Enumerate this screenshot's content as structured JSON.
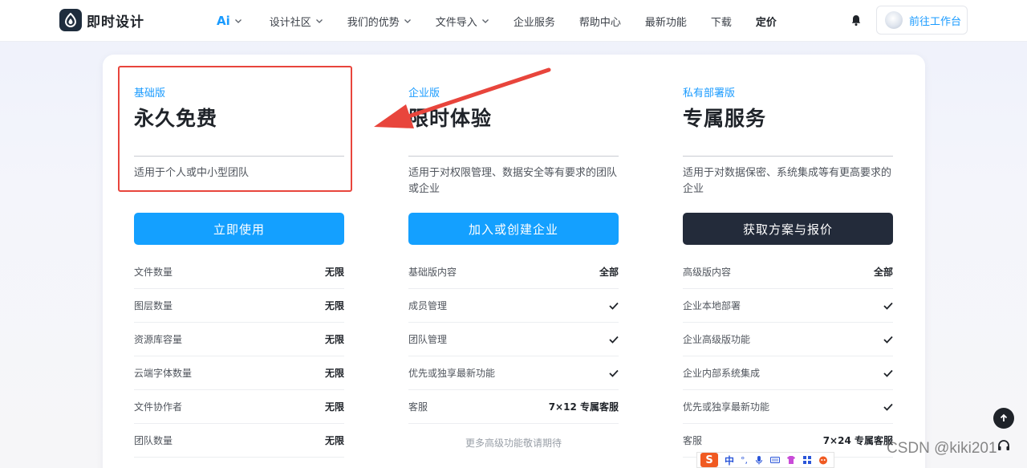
{
  "brand": {
    "name": "即时设计"
  },
  "nav": {
    "items": [
      {
        "label": "Ai",
        "dropdown": true
      },
      {
        "label": "设计社区",
        "dropdown": true
      },
      {
        "label": "我们的优势",
        "dropdown": true
      },
      {
        "label": "文件导入",
        "dropdown": true
      },
      {
        "label": "企业服务",
        "dropdown": false
      },
      {
        "label": "帮助中心",
        "dropdown": false
      },
      {
        "label": "最新功能",
        "dropdown": false
      },
      {
        "label": "下载",
        "dropdown": false
      },
      {
        "label": "定价",
        "dropdown": false,
        "active": true
      }
    ],
    "workbench_label": "前往工作台"
  },
  "plans": [
    {
      "tag": "基础版",
      "name": "永久免费",
      "desc": "适用于个人或中小型团队",
      "cta": "立即使用",
      "features": [
        {
          "label": "文件数量",
          "value": "无限"
        },
        {
          "label": "图层数量",
          "value": "无限"
        },
        {
          "label": "资源库容量",
          "value": "无限"
        },
        {
          "label": "云端字体数量",
          "value": "无限"
        },
        {
          "label": "文件协作者",
          "value": "无限"
        },
        {
          "label": "团队数量",
          "value": "无限"
        }
      ]
    },
    {
      "tag": "企业版",
      "name": "限时体验",
      "desc": "适用于对权限管理、数据安全等有要求的团队或企业",
      "cta": "加入或创建企业",
      "features": [
        {
          "label": "基础版内容",
          "value": "全部"
        },
        {
          "label": "成员管理",
          "value": "check"
        },
        {
          "label": "团队管理",
          "value": "check"
        },
        {
          "label": "优先或独享最新功能",
          "value": "check"
        },
        {
          "label": "客服",
          "value": "7×12 专属客服"
        }
      ],
      "note": "更多高级功能敬请期待"
    },
    {
      "tag": "私有部署版",
      "name": "专属服务",
      "desc": "适用于对数据保密、系统集成等有更高要求的企业",
      "cta": "获取方案与报价",
      "features": [
        {
          "label": "高级版内容",
          "value": "全部"
        },
        {
          "label": "企业本地部署",
          "value": "check"
        },
        {
          "label": "企业高级版功能",
          "value": "check"
        },
        {
          "label": "企业内部系统集成",
          "value": "check"
        },
        {
          "label": "优先或独享最新功能",
          "value": "check"
        },
        {
          "label": "客服",
          "value": "7×24 专属客服"
        }
      ]
    }
  ],
  "ime": {
    "badge": "S",
    "mode": "中",
    "punct": "°,"
  },
  "watermark": "CSDN @kiki201",
  "colors": {
    "accent": "#1a9bff",
    "cta_dark": "#232b3a",
    "annotation": "#e8453c"
  }
}
